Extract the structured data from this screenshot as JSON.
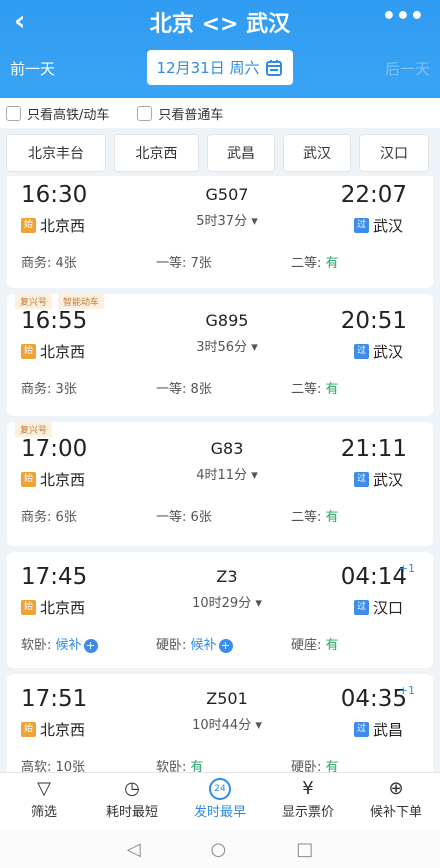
{
  "header": {
    "title": "北京 <> 武汉",
    "back": "‹",
    "more": "•••",
    "prev_day": "前一天",
    "next_day": "后一天",
    "date": "12月31日 周六"
  },
  "filters": {
    "high_speed": "只看高铁/动车",
    "normal": "只看普通车"
  },
  "stations": [
    "北京丰台",
    "北京西",
    "武昌",
    "武汉",
    "汉口"
  ],
  "trains": [
    {
      "tags": [],
      "dep_time": "16:30",
      "train": "G507",
      "duration": "5时37分",
      "arr_time": "22:07",
      "plus": "",
      "dep_badge": "始",
      "dep_station": "北京西",
      "arr_badge": "过",
      "arr_station": "武汉",
      "seats": [
        {
          "label": "商务: ",
          "value": "4张",
          "style": ""
        },
        {
          "label": "一等: ",
          "value": "7张",
          "style": ""
        },
        {
          "label": "二等: ",
          "value": "有",
          "style": "v"
        }
      ]
    },
    {
      "tags": [
        "复兴号",
        "智能动车"
      ],
      "dep_time": "16:55",
      "train": "G895",
      "duration": "3时56分",
      "arr_time": "20:51",
      "plus": "",
      "dep_badge": "始",
      "dep_station": "北京西",
      "arr_badge": "过",
      "arr_station": "武汉",
      "seats": [
        {
          "label": "商务: ",
          "value": "3张",
          "style": ""
        },
        {
          "label": "一等: ",
          "value": "8张",
          "style": ""
        },
        {
          "label": "二等: ",
          "value": "有",
          "style": "v"
        }
      ]
    },
    {
      "tags": [
        "复兴号"
      ],
      "dep_time": "17:00",
      "train": "G83",
      "duration": "4时11分",
      "arr_time": "21:11",
      "plus": "",
      "dep_badge": "始",
      "dep_station": "北京西",
      "arr_badge": "过",
      "arr_station": "武汉",
      "seats": [
        {
          "label": "商务: ",
          "value": "6张",
          "style": ""
        },
        {
          "label": "一等: ",
          "value": "6张",
          "style": ""
        },
        {
          "label": "二等: ",
          "value": "有",
          "style": "v"
        }
      ]
    },
    {
      "tags": [],
      "dep_time": "17:45",
      "train": "Z3",
      "duration": "10时29分",
      "arr_time": "04:14",
      "plus": "+1",
      "dep_badge": "始",
      "dep_station": "北京西",
      "arr_badge": "过",
      "arr_station": "汉口",
      "seats": [
        {
          "label": "软卧: ",
          "value": "候补",
          "style": "vb"
        },
        {
          "label": "硬卧: ",
          "value": "候补",
          "style": "vb"
        },
        {
          "label": "硬座: ",
          "value": "有",
          "style": "v"
        }
      ]
    },
    {
      "tags": [],
      "dep_time": "17:51",
      "train": "Z501",
      "duration": "10时44分",
      "arr_time": "04:35",
      "plus": "+1",
      "dep_badge": "始",
      "dep_station": "北京西",
      "arr_badge": "过",
      "arr_station": "武昌",
      "seats": [
        {
          "label": "高软: ",
          "value": "10张",
          "style": ""
        },
        {
          "label": "软卧: ",
          "value": "有",
          "style": "v"
        },
        {
          "label": "硬卧: ",
          "value": "有",
          "style": "v"
        }
      ]
    }
  ],
  "tabbar": [
    {
      "icon": "filter-icon",
      "glyph": "▽",
      "label": "筛选"
    },
    {
      "icon": "timer-icon",
      "glyph": "◷",
      "label": "耗时最短"
    },
    {
      "icon": "clock-24-icon",
      "glyph": "24",
      "label": "发时最早"
    },
    {
      "icon": "yen-icon",
      "glyph": "¥",
      "label": "显示票价"
    },
    {
      "icon": "cart-icon",
      "glyph": "⊕",
      "label": "候补下单"
    }
  ],
  "active_tab": 2
}
